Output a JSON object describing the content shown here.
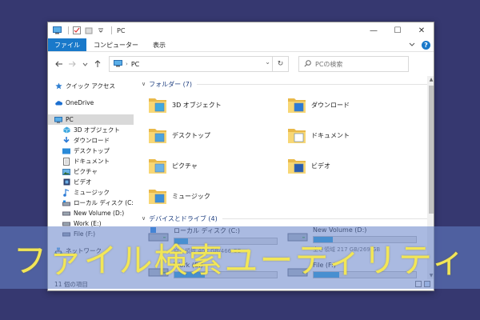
{
  "window": {
    "title": "PC",
    "controls": {
      "minimize": "—",
      "maximize": "☐",
      "close": "✕"
    }
  },
  "ribbon": {
    "tabs": [
      "ファイル",
      "コンピューター",
      "表示"
    ],
    "collapse_icon": "chevron-down-icon",
    "help_label": "?"
  },
  "address": {
    "path": "PC",
    "search_placeholder": "PCの検索"
  },
  "sidebar": {
    "items": [
      {
        "label": "クイック アクセス",
        "icon": "star-icon"
      },
      {
        "label": "OneDrive",
        "icon": "cloud-icon"
      },
      {
        "label": "PC",
        "icon": "pc-icon",
        "selected": true
      },
      {
        "label": "3D オブジェクト",
        "icon": "cube-icon"
      },
      {
        "label": "ダウンロード",
        "icon": "download-icon"
      },
      {
        "label": "デスクトップ",
        "icon": "desktop-icon"
      },
      {
        "label": "ドキュメント",
        "icon": "document-icon"
      },
      {
        "label": "ピクチャ",
        "icon": "picture-icon"
      },
      {
        "label": "ビデオ",
        "icon": "video-icon"
      },
      {
        "label": "ミュージック",
        "icon": "music-icon"
      },
      {
        "label": "ローカル ディスク (C:)",
        "icon": "drive-icon"
      },
      {
        "label": "New Volume (D:)",
        "icon": "drive-icon"
      },
      {
        "label": "Work (E:)",
        "icon": "drive-icon"
      },
      {
        "label": "File (F:)",
        "icon": "drive-icon"
      },
      {
        "label": "ネットワーク",
        "icon": "network-icon"
      }
    ]
  },
  "folders_section": {
    "header": "フォルダー (7)",
    "items": [
      {
        "label": "3D オブジェクト",
        "accent": "#3fa9e0"
      },
      {
        "label": "ダウンロード",
        "accent": "#2c7bd6"
      },
      {
        "label": "デスクトップ",
        "accent": "#4aa3df"
      },
      {
        "label": "ドキュメント",
        "accent": "#ffffff"
      },
      {
        "label": "ピクチャ",
        "accent": "#6bb3e6"
      },
      {
        "label": "ビデオ",
        "accent": "#2a5cae"
      },
      {
        "label": "ミュージック",
        "accent": "#3b8fd9"
      }
    ]
  },
  "drives_section": {
    "header": "デバイスとドライブ (4)",
    "items": [
      {
        "label": "ローカル ディスク (C:)",
        "space": "空き領域 40X GB/466 GB",
        "used_fraction": 0.13
      },
      {
        "label": "New Volume (D:)",
        "space": "空き領域 217 GB/269 GB",
        "used_fraction": 0.19
      },
      {
        "label": "Work (E:)",
        "space": "",
        "used_fraction": 0.3
      },
      {
        "label": "File (F:)",
        "space": "",
        "used_fraction": 0.25
      }
    ]
  },
  "status": {
    "count": "11 個の項目"
  },
  "banner": {
    "text": "ファイル検索ユーティリティ"
  },
  "colors": {
    "background": "#363870",
    "accent": "#1979ca",
    "drive_fill": "#26a0da",
    "banner_text": "#f2e657"
  }
}
